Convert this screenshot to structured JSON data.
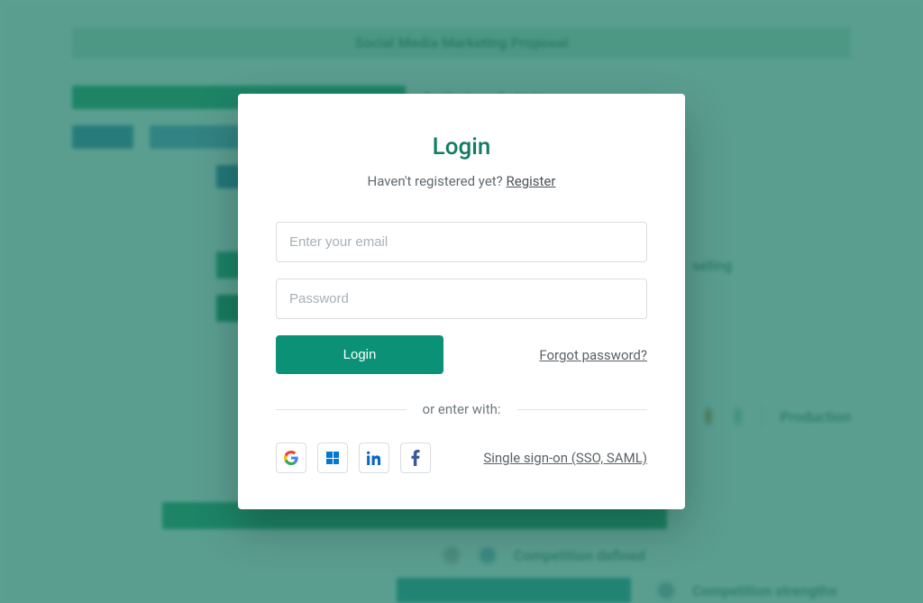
{
  "background": {
    "project_title": "Social Media Marketing Proposal",
    "rows": {
      "analysis_strategy": "Analysis and strategy",
      "marketing_suffix": "seting",
      "production": "Production",
      "competition_defined": "Competition defined",
      "competition_strengths": "Competition strengths"
    }
  },
  "modal": {
    "title": "Login",
    "register_prompt": "Haven't registered yet? ",
    "register_link": "Register",
    "email_placeholder": "Enter your email",
    "password_placeholder": "Password",
    "login_button": "Login",
    "forgot_link": "Forgot password?",
    "separator": "or enter with:",
    "sso_link": "Single sign-on (SSO, SAML)"
  },
  "colors": {
    "accent": "#0b9276",
    "overlay": "rgba(15,115,95,0.68)"
  }
}
